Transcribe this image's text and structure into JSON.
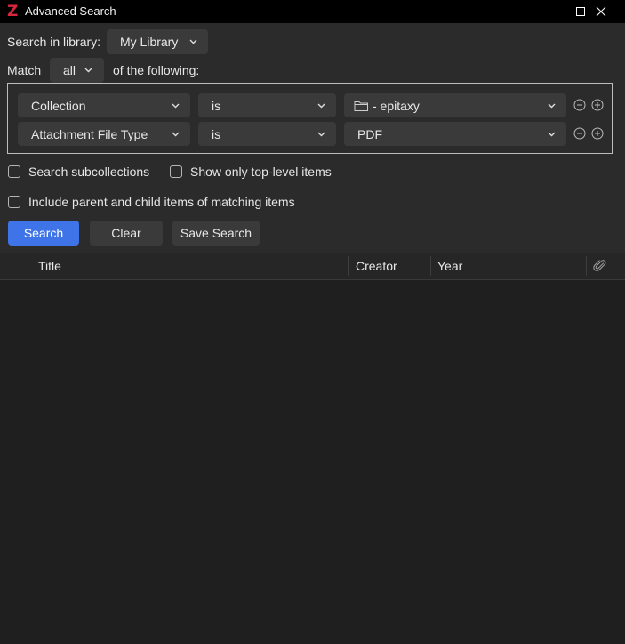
{
  "window": {
    "title": "Advanced Search",
    "logo": "Z",
    "controls": [
      "minimize-icon",
      "maximize-icon",
      "close-icon"
    ]
  },
  "search_in": {
    "label": "Search in library:",
    "value": "My Library"
  },
  "match": {
    "label": "Match",
    "value": "all",
    "suffix": "of the following:"
  },
  "conditions": [
    {
      "field": "Collection",
      "operator": "is",
      "value": "- epitaxy",
      "value_icon": "folder-icon"
    },
    {
      "field": "Attachment File Type",
      "operator": "is",
      "value": "PDF"
    }
  ],
  "options": {
    "subcollections": {
      "label": "Search subcollections",
      "checked": false
    },
    "top_level": {
      "label": "Show only top-level items",
      "checked": false
    },
    "parent_child": {
      "label": "Include parent and child items of matching items",
      "checked": false
    }
  },
  "buttons": {
    "search": "Search",
    "clear": "Clear",
    "save": "Save Search"
  },
  "results_table": {
    "columns": [
      "Title",
      "Creator",
      "Year"
    ],
    "attachment_column_icon": "paperclip-icon",
    "rows": []
  },
  "colors": {
    "accent": "#3f74e8",
    "logo": "#d7263d",
    "background": "#1f1f1f",
    "panel": "#2b2b2b"
  }
}
